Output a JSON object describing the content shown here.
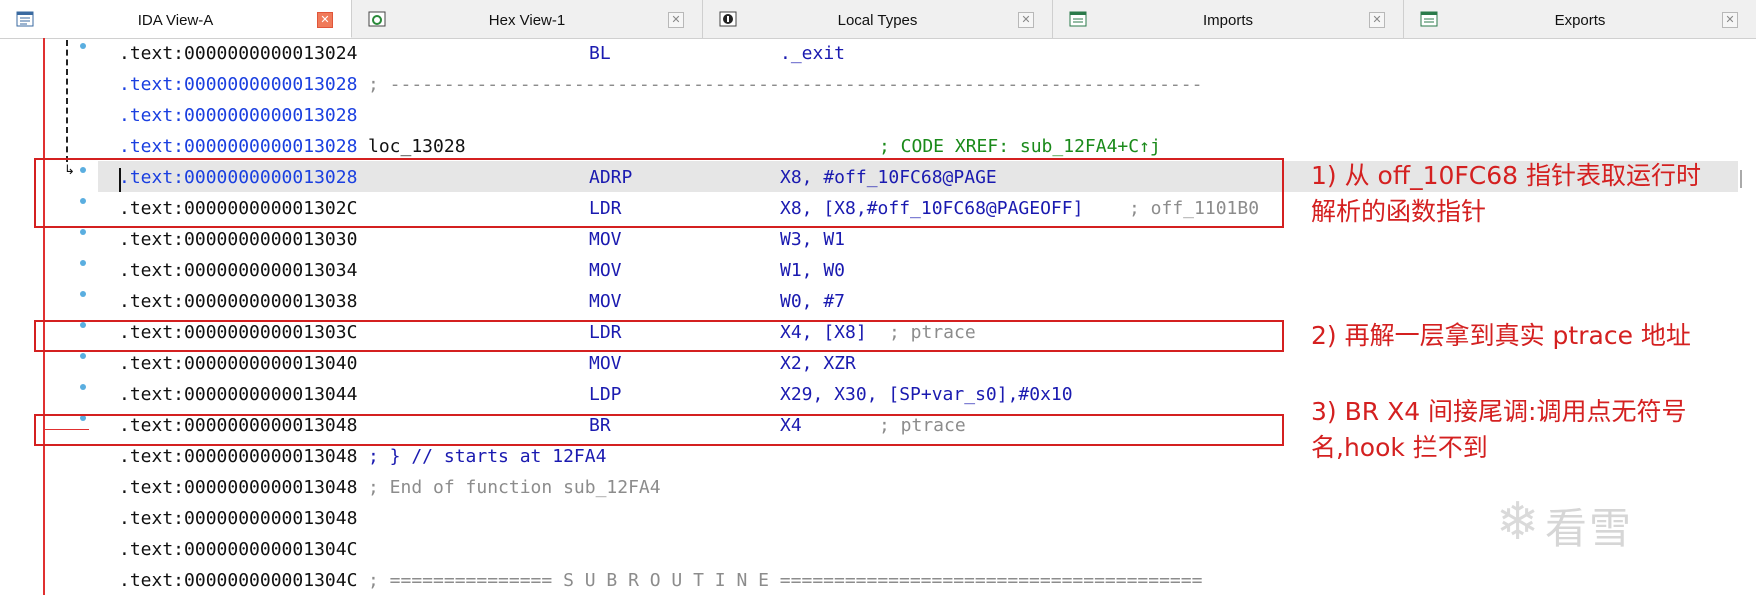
{
  "tabs": [
    {
      "label": "IDA View-A",
      "icon": "ida-view-icon",
      "active": true
    },
    {
      "label": "Hex View-1",
      "icon": "hex-view-icon",
      "active": false
    },
    {
      "label": "Local Types",
      "icon": "local-types-icon",
      "active": false
    },
    {
      "label": "Imports",
      "icon": "imports-icon",
      "active": false
    },
    {
      "label": "Exports",
      "icon": "exports-icon",
      "active": false
    }
  ],
  "tab_close": "✕",
  "lines": [
    {
      "addr": ".text:0000000000013024",
      "label": "",
      "mnem": "BL",
      "oper": "._exit",
      "comment": ""
    },
    {
      "addr": ".text:0000000000013028",
      "label": "",
      "mnem": "",
      "oper": "",
      "comment": "; ---------------------------------------------------------------------------"
    },
    {
      "addr": ".text:0000000000013028",
      "label": "",
      "mnem": "",
      "oper": "",
      "comment": ""
    },
    {
      "addr": ".text:0000000000013028",
      "label": "loc_13028",
      "mnem": "",
      "oper": "",
      "comment": "; CODE XREF: sub_12FA4+C↑j"
    },
    {
      "addr": ".text:0000000000013028",
      "label": "",
      "mnem": "ADRP",
      "oper": "X8, #off_10FC68@PAGE",
      "comment": ""
    },
    {
      "addr": ".text:000000000001302C",
      "label": "",
      "mnem": "LDR",
      "oper": "X8, [X8,#off_10FC68@PAGEOFF]",
      "comment": "; off_1101B0"
    },
    {
      "addr": ".text:0000000000013030",
      "label": "",
      "mnem": "MOV",
      "oper": "W3, W1",
      "comment": ""
    },
    {
      "addr": ".text:0000000000013034",
      "label": "",
      "mnem": "MOV",
      "oper": "W1, W0",
      "comment": ""
    },
    {
      "addr": ".text:0000000000013038",
      "label": "",
      "mnem": "MOV",
      "oper": "W0, #7",
      "comment": ""
    },
    {
      "addr": ".text:000000000001303C",
      "label": "",
      "mnem": "LDR",
      "oper": "X4, [X8]",
      "comment": "; ptrace"
    },
    {
      "addr": ".text:0000000000013040",
      "label": "",
      "mnem": "MOV",
      "oper": "X2, XZR",
      "comment": ""
    },
    {
      "addr": ".text:0000000000013044",
      "label": "",
      "mnem": "LDP",
      "oper": "X29, X30, [SP+var_s0],#0x10",
      "comment": ""
    },
    {
      "addr": ".text:0000000000013048",
      "label": "",
      "mnem": "BR",
      "oper": "X4",
      "comment": "; ptrace"
    },
    {
      "addr": ".text:0000000000013048",
      "label": "",
      "mnem": "",
      "oper": "",
      "comment": "; } // starts at 12FA4"
    },
    {
      "addr": ".text:0000000000013048",
      "label": "",
      "mnem": "",
      "oper": "",
      "comment": "; End of function sub_12FA4"
    },
    {
      "addr": ".text:0000000000013048",
      "label": "",
      "mnem": "",
      "oper": "",
      "comment": ""
    },
    {
      "addr": ".text:000000000001304C",
      "label": "",
      "mnem": "",
      "oper": "",
      "comment": ""
    },
    {
      "addr": ".text:000000000001304C",
      "label": "",
      "mnem": "",
      "oper": "",
      "comment": "; =============== S U B R O U T I N E ======================================="
    }
  ],
  "annotations": [
    {
      "line1": "1) 从 off_10FC68 指针表取运行时",
      "line2": "解析的函数指针"
    },
    {
      "line1": "2) 再解一层拿到真实 ptrace 地址",
      "line2": ""
    },
    {
      "line1": "3) BR X4 间接尾调:调用点无符号",
      "line2": "名,hook 拦不到"
    }
  ],
  "watermark": "看雪",
  "colors": {
    "annotation": "#d42020",
    "address_blue": "#1a3fe0",
    "active_tab_close": "#f07a5a"
  }
}
